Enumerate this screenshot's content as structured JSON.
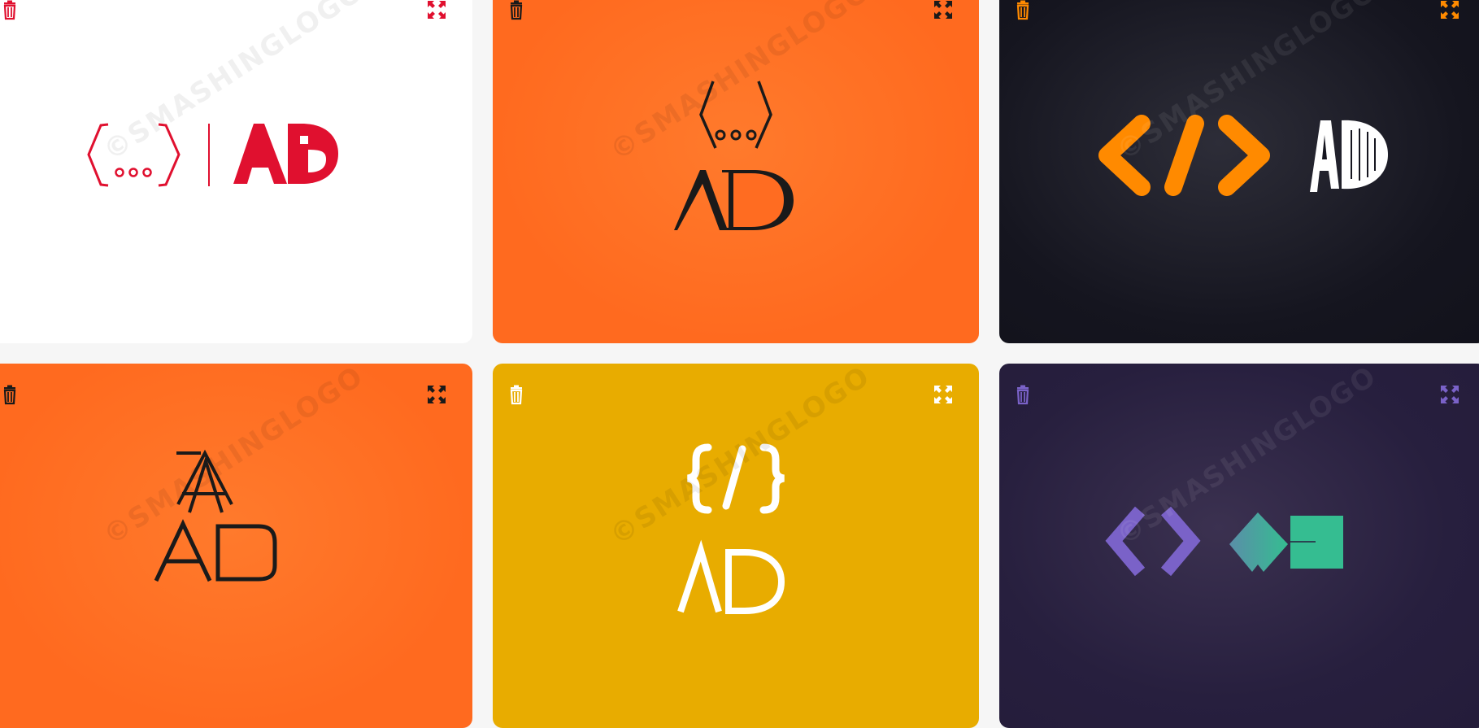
{
  "gallery": {
    "watermark": "©SMASHINGLOGO",
    "cards": [
      {
        "monogram": "AD",
        "theme": "red-on-white",
        "accent": "#e0102f",
        "icons": [
          "delete-icon",
          "expand-icon"
        ]
      },
      {
        "monogram": "AD",
        "theme": "black-on-orange",
        "accent": "#1a1a1a",
        "icons": [
          "delete-icon",
          "expand-icon"
        ]
      },
      {
        "monogram": "AD",
        "theme": "orange-on-dark",
        "accent": "#ff8a00",
        "icons": [
          "delete-icon",
          "expand-icon"
        ]
      },
      {
        "monogram": "AD",
        "theme": "black-on-orange",
        "accent": "#1a1a1a",
        "icons": [
          "delete-icon",
          "expand-icon"
        ]
      },
      {
        "monogram": "AD",
        "theme": "white-on-mustard",
        "accent": "#ffffff",
        "icons": [
          "delete-icon",
          "expand-icon"
        ]
      },
      {
        "monogram": "",
        "theme": "purple-teal-on-dark",
        "accent": "#7a62c8",
        "icons": [
          "delete-icon",
          "expand-icon"
        ]
      }
    ]
  },
  "colors": {
    "page_bg": "#f6f6f6",
    "red": "#e0102f",
    "orange": "#ff6a1f",
    "dark": "#15151f",
    "mustard": "#e8ac00",
    "purple_bg": "#271f3e",
    "violet": "#7a62c8",
    "teal": "#35bd91"
  }
}
